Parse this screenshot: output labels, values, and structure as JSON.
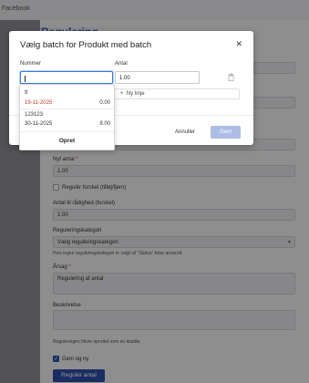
{
  "topbar": {
    "crumb": "Facebook"
  },
  "background": {
    "title": "Regulering"
  },
  "form": {
    "new_qty_label": "Nyt antal",
    "new_qty_required": "*",
    "new_qty_value": "1.00",
    "regulate_diff_label": "Regulér forskel (tilføj/fjern)",
    "available_label": "Antal til rådighed (forskel)",
    "available_value": "1.00",
    "category_label": "Reguleringskategori",
    "category_value": "Vælg reguleringskategori",
    "category_hint": "Hvis ingen reguleringskategori er valgt vil \"Status\" blive anvendt.",
    "reason_label": "Årsag",
    "reason_required": "*",
    "reason_value": "Regulering af antal",
    "description_label": "Beskrivelse",
    "description_value": "",
    "draft_hint": "Reguleringen bliver oprettet som en kladde.",
    "save_new_label": "Gem og ny",
    "submit_label": "Regulér antal"
  },
  "modal": {
    "title": "Vælg batch for Produkt med batch",
    "col_number": "Nummer",
    "col_qty": "Antal",
    "number_value": "",
    "qty_value": "1.00",
    "new_line_label": "Ny linje",
    "cancel_label": "Annuller",
    "save_label": "Gem"
  },
  "dropdown": {
    "options": [
      {
        "number": "9",
        "date": "19-11-2025",
        "qty": "0.00",
        "date_color": "#d0342c"
      },
      {
        "number": "123123",
        "date": "30-11-2025",
        "qty": "9.00",
        "date_color": "#333333"
      }
    ],
    "create_label": "Opret"
  },
  "colors": {
    "primary": "#2d4fa8",
    "save_disabled": "#aebde6",
    "focus": "#3a7be0"
  }
}
